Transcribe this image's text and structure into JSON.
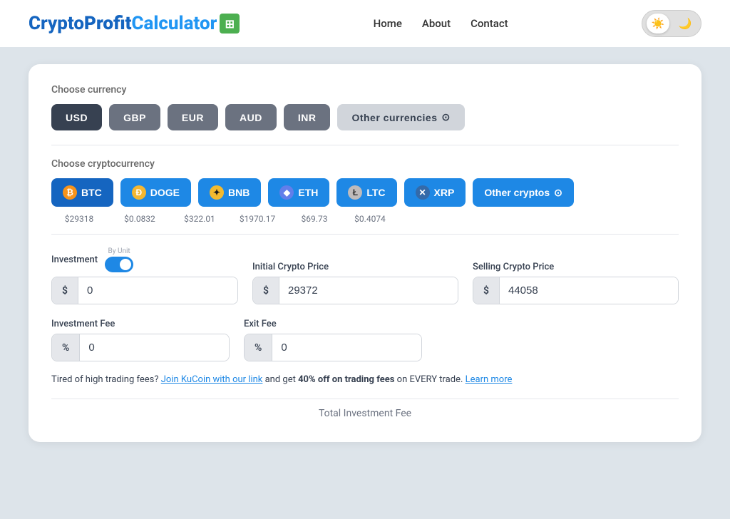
{
  "nav": {
    "logo": {
      "crypto": "Crypto",
      "profit": "Profit",
      "calculator": "Calculator",
      "icon": "🖩"
    },
    "links": [
      "Home",
      "About",
      "Contact"
    ],
    "theme": {
      "sun": "☀️",
      "moon": "🌙"
    }
  },
  "currency": {
    "label": "Choose currency",
    "buttons": [
      "USD",
      "GBP",
      "EUR",
      "AUD",
      "INR"
    ],
    "other_label": "Other currencies",
    "active": "USD"
  },
  "crypto": {
    "label": "Choose cryptocurrency",
    "coins": [
      {
        "id": "BTC",
        "icon": "₿",
        "icon_class": "icon-btc",
        "price": "$29318"
      },
      {
        "id": "DOGE",
        "icon": "Ð",
        "icon_class": "icon-doge",
        "price": "$0.0832"
      },
      {
        "id": "BNB",
        "icon": "✦",
        "icon_class": "icon-bnb",
        "price": "$322.01"
      },
      {
        "id": "ETH",
        "icon": "◆",
        "icon_class": "icon-eth",
        "price": "$1970.17"
      },
      {
        "id": "LTC",
        "icon": "Ł",
        "icon_class": "icon-ltc",
        "price": "$69.73"
      },
      {
        "id": "XRP",
        "icon": "✕",
        "icon_class": "icon-xrp",
        "price": "$0.4074"
      }
    ],
    "other_label": "Other cryptos",
    "active": "BTC"
  },
  "form": {
    "by_unit_label": "By Unit",
    "investment": {
      "label": "Investment",
      "prefix": "$",
      "value": "0"
    },
    "initial_price": {
      "label": "Initial Crypto Price",
      "prefix": "$",
      "value": "29372"
    },
    "selling_price": {
      "label": "Selling Crypto Price",
      "prefix": "$",
      "value": "44058"
    },
    "investment_fee": {
      "label": "Investment Fee",
      "prefix": "%",
      "value": "0"
    },
    "exit_fee": {
      "label": "Exit Fee",
      "prefix": "%",
      "value": "0"
    }
  },
  "promo": {
    "text_before": "Tired of high trading fees?",
    "link_text": "Join KuCoin with our link",
    "text_middle": "and get",
    "bold_text": "40% off on trading fees",
    "text_after": "on EVERY trade.",
    "learn_more": "Learn more"
  },
  "footer": {
    "total_label": "Total Investment Fee"
  }
}
